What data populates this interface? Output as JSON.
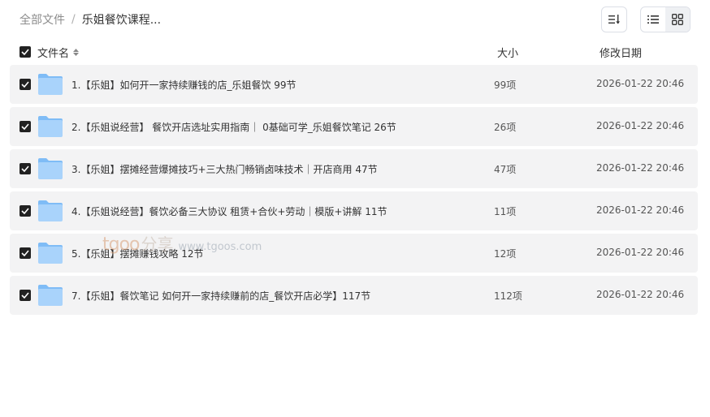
{
  "breadcrumb": {
    "root": "全部文件",
    "separator": "/",
    "current": "乐姐餐饮课程..."
  },
  "toolbar": {
    "sort_icon": "sort-list-icon",
    "list_view_icon": "list-view-icon",
    "grid_view_icon": "grid-view-icon"
  },
  "columns": {
    "name": "文件名",
    "size": "大小",
    "date": "修改日期"
  },
  "rows": [
    {
      "name": "1.【乐姐】如何开一家持续赚钱的店_乐姐餐饮 99节",
      "size": "99项",
      "date": "2026-01-22 20:46",
      "checked": true
    },
    {
      "name": "2.【乐姐说经营】 餐饮开店选址实用指南｜ 0基础可学_乐姐餐饮笔记 26节",
      "size": "26项",
      "date": "2026-01-22 20:46",
      "checked": true
    },
    {
      "name": "3.【乐姐】摆摊经营爆摊技巧+三大热门畅销卤味技术｜开店商用 47节",
      "size": "47项",
      "date": "2026-01-22 20:46",
      "checked": true
    },
    {
      "name": "4.【乐姐说经营】餐饮必备三大协议 租赁+合伙+劳动｜模版+讲解 11节",
      "size": "11项",
      "date": "2026-01-22 20:46",
      "checked": true
    },
    {
      "name": "5.【乐姐】摆摊赚钱攻略 12节",
      "size": "12项",
      "date": "2026-01-22 20:46",
      "checked": true
    },
    {
      "name": "7.【乐姐】餐饮笔记 如何开一家持续赚前的店_餐饮开店必学】117节",
      "size": "112项",
      "date": "2026-01-22 20:46",
      "checked": true
    }
  ],
  "watermark": {
    "logo": "tgoo",
    "logo_suffix": "分享",
    "url": "www.tgoos.com"
  },
  "colors": {
    "folder_light": "#a9d3fb",
    "folder_dark": "#7fbcf6",
    "row_bg": "#f3f3f4",
    "checkbox": "#222222"
  }
}
